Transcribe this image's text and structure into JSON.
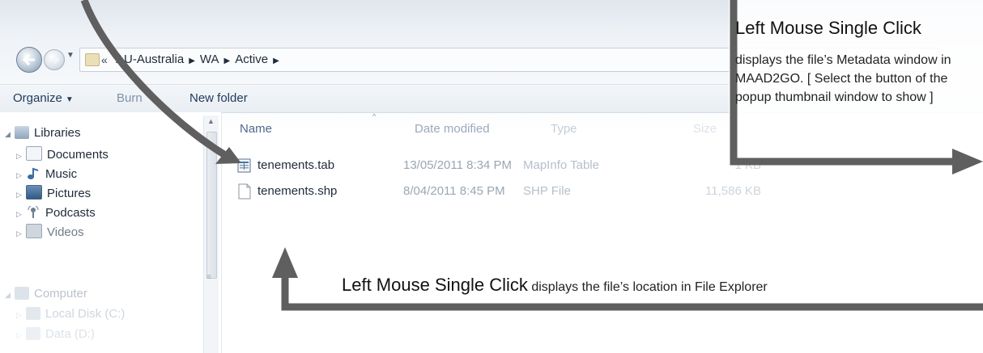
{
  "nav": {
    "breadcrumb_prefix": "«",
    "breadcrumbs": [
      "AU-Australia",
      "WA",
      "Active"
    ]
  },
  "toolbar": {
    "organize_label": "Organize",
    "burn_label": "Burn",
    "new_folder_label": "New folder"
  },
  "sidebar": {
    "items": [
      {
        "label": "Libraries",
        "icon": "libraries-icon"
      },
      {
        "label": "Documents",
        "icon": "documents-icon"
      },
      {
        "label": "Music",
        "icon": "music-icon"
      },
      {
        "label": "Pictures",
        "icon": "pictures-icon"
      },
      {
        "label": "Podcasts",
        "icon": "podcasts-icon"
      },
      {
        "label": "Videos",
        "icon": "videos-icon"
      },
      {
        "label": "Computer",
        "icon": "computer-icon"
      },
      {
        "label": "Local Disk (C:)",
        "icon": "drive-icon"
      },
      {
        "label": "Data (D:)",
        "icon": "drive-icon"
      }
    ]
  },
  "columns": {
    "name": "Name",
    "date": "Date modified",
    "type": "Type",
    "size": "Size"
  },
  "files": [
    {
      "name": "tenements.tab",
      "date": "13/05/2011 8:34 PM",
      "type": "MapInfo Table",
      "size": "1 KB",
      "icon": "mapinfo-table-icon"
    },
    {
      "name": "tenements.shp",
      "date": "8/04/2011 8:45 PM",
      "type": "SHP File",
      "size": "11,586 KB",
      "icon": "blank-file-icon"
    }
  ],
  "annotations": {
    "top_right_title": "Left Mouse Single Click",
    "top_right_body": "displays the file’s Metadata window in MAAD2GO. [ Select the button of the popup thumbnail window  to show ]",
    "bottom_title": "Left Mouse Single Click",
    "bottom_body": "displays the file’s location in File Explorer"
  },
  "colors": {
    "arrow": "#5f5f5f",
    "accent_text": "#1e3a5a"
  }
}
